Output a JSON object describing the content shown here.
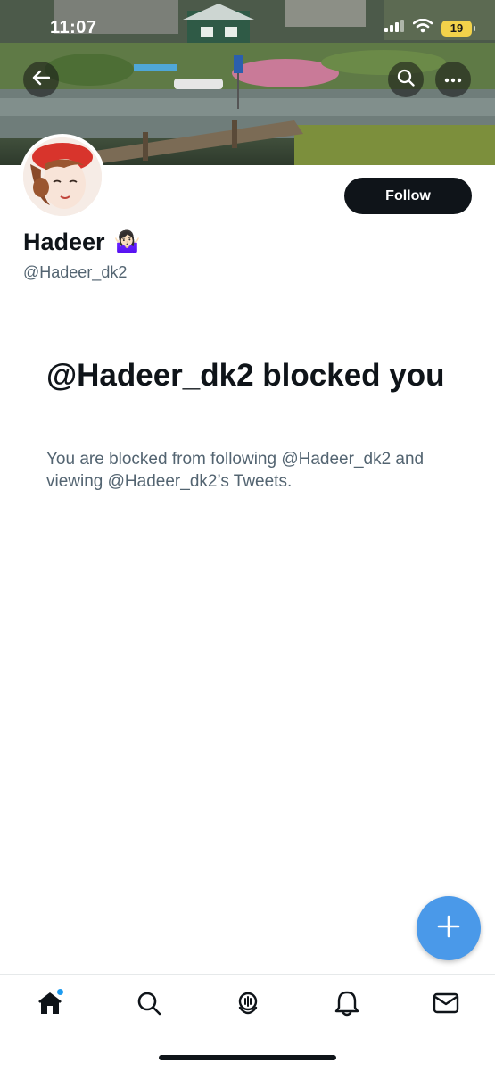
{
  "status_bar": {
    "time": "11:07",
    "battery": "19",
    "icons": [
      "signal-icon",
      "wifi-icon",
      "battery-icon"
    ]
  },
  "header": {
    "back_icon": "back-arrow-icon",
    "search_icon": "search-icon",
    "more_icon": "more-icon"
  },
  "profile": {
    "display_name": "Hadeer",
    "name_emoji": "🤷🏻‍♀️",
    "handle": "@Hadeer_dk2",
    "follow_label": "Follow"
  },
  "blocked": {
    "title": "@Hadeer_dk2 blocked you",
    "description": "You are blocked from following @Hadeer_dk2 and viewing @Hadeer_dk2’s Tweets."
  },
  "fab": {
    "icon": "plus-icon"
  },
  "tabbar": {
    "items": [
      {
        "icon": "home-icon",
        "has_badge": true
      },
      {
        "icon": "search-icon"
      },
      {
        "icon": "spaces-icon"
      },
      {
        "icon": "bell-icon"
      },
      {
        "icon": "mail-icon"
      }
    ]
  },
  "colors": {
    "accent": "#1d9bf0",
    "fab": "#4a99e9",
    "text_primary": "#0f1419",
    "text_secondary": "#536471",
    "battery": "#f2d24a"
  }
}
